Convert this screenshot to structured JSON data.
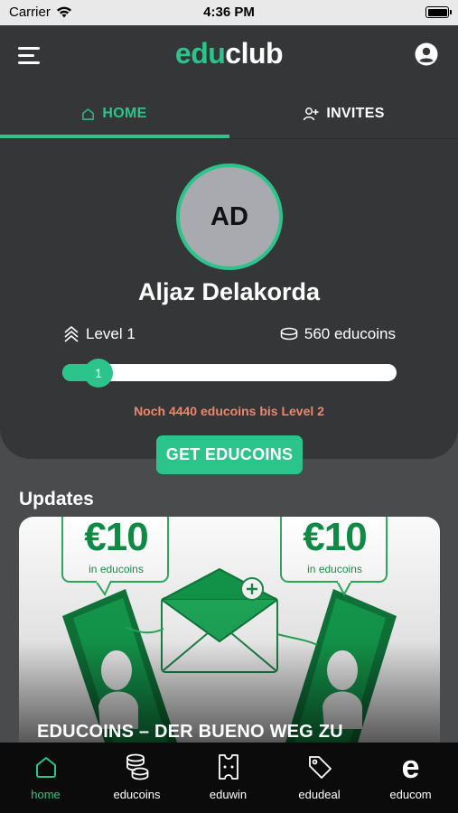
{
  "status_bar": {
    "carrier": "Carrier",
    "time": "4:36 PM"
  },
  "header": {
    "logo_part1": "edu",
    "logo_part2": "club"
  },
  "tabs": [
    {
      "label": "HOME",
      "icon": "home-icon",
      "active": true
    },
    {
      "label": "INVITES",
      "icon": "add-user-icon",
      "active": false
    }
  ],
  "profile": {
    "initials": "AD",
    "name": "Aljaz Delakorda",
    "level_label": "Level 1",
    "coins_label": "560 educoins",
    "progress_level": "1",
    "progress_fraction": 0.14,
    "next_level_text": "Noch 4440 educoins bis Level 2"
  },
  "cta": {
    "label": "GET EDUCOINS"
  },
  "updates": {
    "title": "Updates",
    "card": {
      "title": "EDUCOINS – DER BUENO WEG ZU",
      "bubble_amount": "€10",
      "bubble_caption": "in educoins"
    }
  },
  "bottom_nav": [
    {
      "label": "home",
      "icon": "home-icon",
      "active": true
    },
    {
      "label": "educoins",
      "icon": "coins-icon",
      "active": false
    },
    {
      "label": "eduwin",
      "icon": "ticket-icon",
      "active": false
    },
    {
      "label": "edudeal",
      "icon": "tag-icon",
      "active": false
    },
    {
      "label": "educom",
      "icon": "e-icon",
      "active": false
    }
  ],
  "colors": {
    "accent": "#2bc48a",
    "panel": "#353638",
    "background": "#4a4b4d",
    "warning_text": "#e8896f"
  }
}
